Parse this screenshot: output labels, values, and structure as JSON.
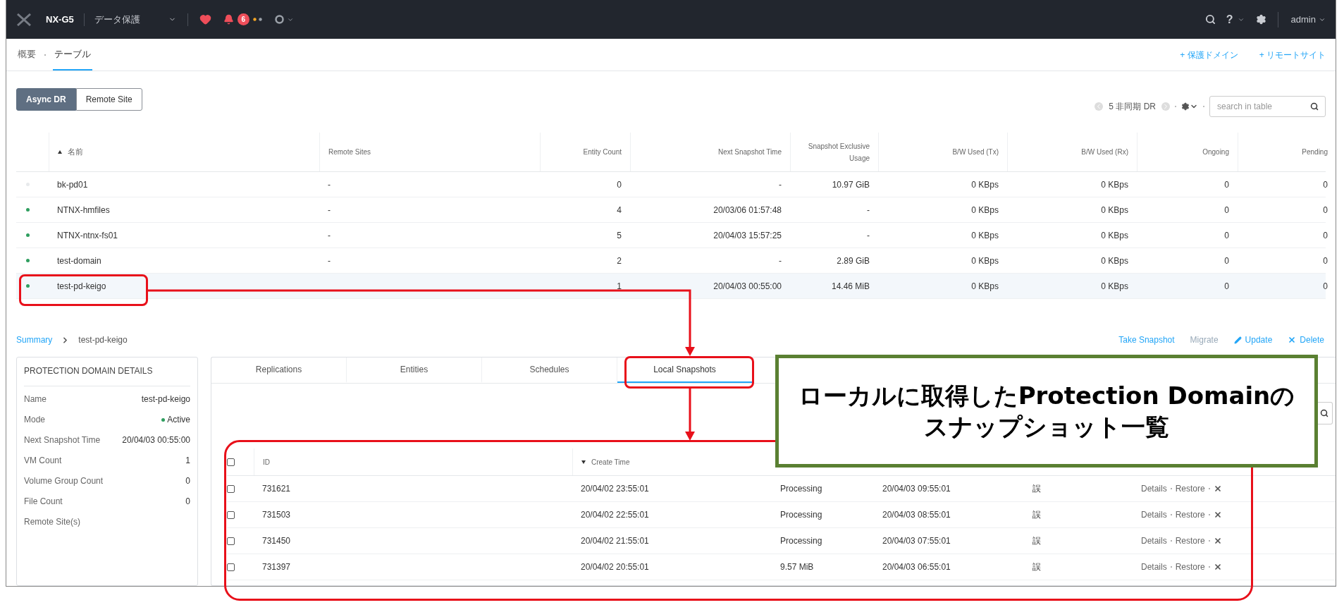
{
  "top_bar": {
    "cluster": "NX-G5",
    "menu": "データ保護",
    "alert_count": "6",
    "help": "?",
    "user": "admin"
  },
  "subnav": {
    "tabs": [
      {
        "label": "概要",
        "selected": false
      },
      {
        "label": "テーブル",
        "selected": true
      }
    ],
    "links": [
      "+ 保護ドメイン",
      "+ リモートサイト"
    ]
  },
  "view_toggle": [
    {
      "label": "Async DR",
      "selected": true
    },
    {
      "label": "Remote Site",
      "selected": false
    }
  ],
  "table_toolbar": {
    "count": "5 非同期 DR",
    "search": {
      "placeholder": "search in table"
    }
  },
  "table": {
    "columns": [
      {
        "label": "名前",
        "sorted": true
      },
      {
        "label": "Remote Sites",
        "sorted": false
      },
      {
        "label": "Entity Count",
        "sorted": false
      },
      {
        "label": "Next Snapshot Time",
        "sorted": false
      },
      {
        "label": "Snapshot Exclusive Usage",
        "sorted": false
      },
      {
        "label": "B/W Used (Tx)",
        "sorted": false
      },
      {
        "label": "B/W Used (Rx)",
        "sorted": false
      },
      {
        "label": "Ongoing",
        "sorted": false
      },
      {
        "label": "Pending",
        "sorted": false
      }
    ],
    "rows": [
      {
        "color": "#e8eaec",
        "selected": false,
        "name": "bk-pd01",
        "remote_sites": "-",
        "entity_count": "0",
        "next_snapshot_time": "-",
        "exclusive_usage": "10.97 GiB",
        "bw_tx": "0 KBps",
        "bw_rx": "0 KBps",
        "ongoing": "0",
        "pending": "0"
      },
      {
        "color": "#2f9e5f",
        "selected": false,
        "name": "NTNX-hmfiles",
        "remote_sites": "-",
        "entity_count": "4",
        "next_snapshot_time": "20/03/06 01:57:48",
        "exclusive_usage": "-",
        "bw_tx": "0 KBps",
        "bw_rx": "0 KBps",
        "ongoing": "0",
        "pending": "0"
      },
      {
        "color": "#2f9e5f",
        "selected": false,
        "name": "NTNX-ntnx-fs01",
        "remote_sites": "-",
        "entity_count": "5",
        "next_snapshot_time": "20/04/03 15:57:25",
        "exclusive_usage": "-",
        "bw_tx": "0 KBps",
        "bw_rx": "0 KBps",
        "ongoing": "0",
        "pending": "0"
      },
      {
        "color": "#2f9e5f",
        "selected": false,
        "name": "test-domain",
        "remote_sites": "-",
        "entity_count": "2",
        "next_snapshot_time": "-",
        "exclusive_usage": "2.89 GiB",
        "bw_tx": "0 KBps",
        "bw_rx": "0 KBps",
        "ongoing": "0",
        "pending": "0"
      },
      {
        "color": "#2f9e5f",
        "selected": true,
        "name": "test-pd-keigo",
        "entity_count": "1",
        "next_snapshot_time": "20/04/03 00:55:00",
        "exclusive_usage": "14.46 MiB",
        "bw_tx": "0 KBps",
        "bw_rx": "0 KBps",
        "ongoing": "0",
        "pending": "0"
      }
    ]
  },
  "breadcrumb": {
    "root": "Summary",
    "current": "test-pd-keigo"
  },
  "actions": [
    {
      "label": "Take Snapshot",
      "kind": "plain",
      "disabled": false
    },
    {
      "label": "Migrate",
      "kind": "plain",
      "disabled": true
    },
    {
      "label": "Update",
      "kind": "edit",
      "disabled": false
    },
    {
      "label": "Delete",
      "kind": "delete",
      "disabled": false
    }
  ],
  "details": {
    "title": "PROTECTION DOMAIN DETAILS",
    "fields": [
      {
        "label": "Name",
        "value": "test-pd-keigo",
        "kind": "text"
      },
      {
        "label": "Mode",
        "value": "Active",
        "kind": "status"
      },
      {
        "label": "Next Snapshot Time",
        "value": "20/04/03 00:55:00",
        "kind": "text"
      },
      {
        "label": "VM Count",
        "value": "1",
        "kind": "text"
      },
      {
        "label": "Volume Group Count",
        "value": "0",
        "kind": "text"
      },
      {
        "label": "File Count",
        "value": "0",
        "kind": "text"
      },
      {
        "label": "Remote Site(s)"
      }
    ]
  },
  "detail_tabs": [
    {
      "label": "Replications",
      "selected": false
    },
    {
      "label": "Entities",
      "selected": false
    },
    {
      "label": "Schedules",
      "selected": false
    },
    {
      "label": "Local Snapshots",
      "selected": true
    }
  ],
  "snapshots": {
    "select_all": {
      "checked": false
    },
    "columns": [
      {
        "label": "ID",
        "sorted": false
      },
      {
        "label": "Create Time",
        "sorted": true
      }
    ],
    "rows": [
      {
        "checked": false,
        "id": "731621",
        "create_time": "20/04/02 23:55:01",
        "reclaimable": "Processing",
        "expiry_time": "20/04/03 09:55:01",
        "column_6": "誤",
        "actions": [
          "Details",
          "Restore"
        ]
      },
      {
        "checked": false,
        "id": "731503",
        "create_time": "20/04/02 22:55:01",
        "reclaimable": "Processing",
        "expiry_time": "20/04/03 08:55:01",
        "column_6": "誤",
        "actions": [
          "Details",
          "Restore"
        ]
      },
      {
        "checked": false,
        "id": "731450",
        "create_time": "20/04/02 21:55:01",
        "reclaimable": "Processing",
        "expiry_time": "20/04/03 07:55:01",
        "column_6": "誤",
        "actions": [
          "Details",
          "Restore"
        ]
      },
      {
        "checked": false,
        "id": "731397",
        "create_time": "20/04/02 20:55:01",
        "reclaimable": "9.57 MiB",
        "expiry_time": "20/04/03 06:55:01",
        "column_6": "誤",
        "actions": [
          "Details",
          "Restore"
        ]
      }
    ]
  },
  "annotation": {
    "callout": [
      "ローカルに取得したProtection Domainの",
      "スナップショット一覧"
    ]
  }
}
